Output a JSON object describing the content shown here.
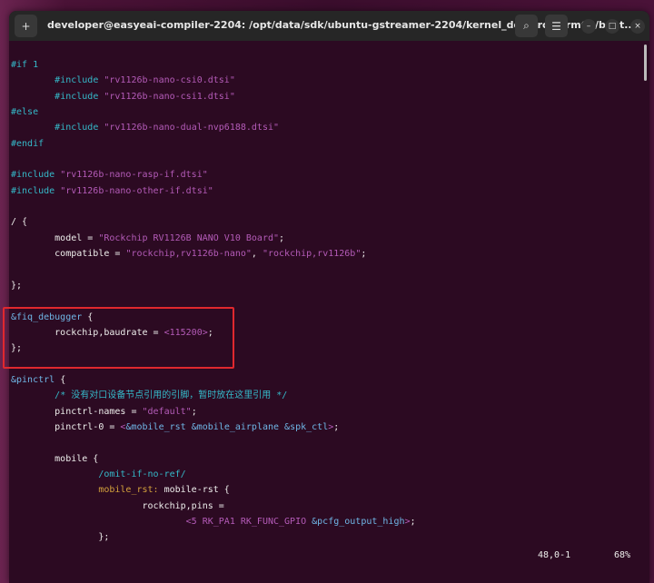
{
  "window": {
    "title": "developer@easyeai-compiler-2204: /opt/data/sdk/ubuntu-gstreamer-2204/kernel_dev/arch/arm64/boot..."
  },
  "buttons": {
    "new_tab": "+",
    "search": "⌕",
    "menu": "☰",
    "minimize": "–",
    "maximize": "□",
    "close": "×"
  },
  "colors": {
    "background": "#2c0a22",
    "highlight_box": "#e0282e"
  },
  "lines": [
    [
      [
        "pp",
        "#if 1"
      ]
    ],
    [
      [
        "txt",
        "        "
      ],
      [
        "pp",
        "#include "
      ],
      [
        "str",
        "\"rv1126b-nano-csi0.dtsi\""
      ]
    ],
    [
      [
        "txt",
        "        "
      ],
      [
        "pp",
        "#include "
      ],
      [
        "str",
        "\"rv1126b-nano-csi1.dtsi\""
      ]
    ],
    [
      [
        "pp",
        "#else"
      ]
    ],
    [
      [
        "txt",
        "        "
      ],
      [
        "pp",
        "#include "
      ],
      [
        "str",
        "\"rv1126b-nano-dual-nvp6188.dtsi\""
      ]
    ],
    [
      [
        "pp",
        "#endif"
      ]
    ],
    [],
    [
      [
        "pp",
        "#include "
      ],
      [
        "str",
        "\"rv1126b-nano-rasp-if.dtsi\""
      ]
    ],
    [
      [
        "pp",
        "#include "
      ],
      [
        "str",
        "\"rv1126b-nano-other-if.dtsi\""
      ]
    ],
    [],
    [
      [
        "txt",
        "/ {"
      ]
    ],
    [
      [
        "txt",
        "        model = "
      ],
      [
        "str",
        "\"Rockchip RV1126B NANO V10 Board\""
      ],
      [
        "txt",
        ";"
      ]
    ],
    [
      [
        "txt",
        "        compatible = "
      ],
      [
        "str",
        "\"rockchip,rv1126b-nano\""
      ],
      [
        "txt",
        ", "
      ],
      [
        "str",
        "\"rockchip,rv1126b\""
      ],
      [
        "txt",
        ";"
      ]
    ],
    [],
    [
      [
        "txt",
        "};"
      ]
    ],
    [],
    [
      [
        "ref",
        "&fiq_debugger"
      ],
      [
        "txt",
        " {"
      ]
    ],
    [
      [
        "txt",
        "        rockchip,baudrate = "
      ],
      [
        "str",
        "<115200>"
      ],
      [
        "txt",
        ";"
      ]
    ],
    [
      [
        "txt",
        "};"
      ]
    ],
    [],
    [
      [
        "ref",
        "&pinctrl"
      ],
      [
        "txt",
        " {"
      ]
    ],
    [
      [
        "txt",
        "        "
      ],
      [
        "cm",
        "/* 没有对口设备节点引用的引脚，暂时放在这里引用 */"
      ]
    ],
    [
      [
        "txt",
        "        pinctrl-names = "
      ],
      [
        "str",
        "\"default\""
      ],
      [
        "txt",
        ";"
      ]
    ],
    [
      [
        "txt",
        "        pinctrl-0 = "
      ],
      [
        "str",
        "<"
      ],
      [
        "ref",
        "&mobile_rst &mobile_airplane &spk_ctl"
      ],
      [
        "str",
        ">"
      ],
      [
        "txt",
        ";"
      ]
    ],
    [],
    [
      [
        "txt",
        "        mobile {"
      ]
    ],
    [
      [
        "txt",
        "                "
      ],
      [
        "pp",
        "/omit-if-no-ref/"
      ]
    ],
    [
      [
        "txt",
        "                "
      ],
      [
        "lbl",
        "mobile_rst:"
      ],
      [
        "txt",
        " mobile-rst {"
      ]
    ],
    [
      [
        "txt",
        "                        rockchip,pins ="
      ]
    ],
    [
      [
        "txt",
        "                                "
      ],
      [
        "str",
        "<5 RK_PA1 RK_FUNC_GPIO "
      ],
      [
        "ref",
        "&pcfg_output_high"
      ],
      [
        "str",
        ">"
      ],
      [
        "txt",
        ";"
      ]
    ],
    [
      [
        "txt",
        "                };"
      ]
    ]
  ],
  "status": {
    "position": "48,0-1",
    "percent": "68%"
  }
}
